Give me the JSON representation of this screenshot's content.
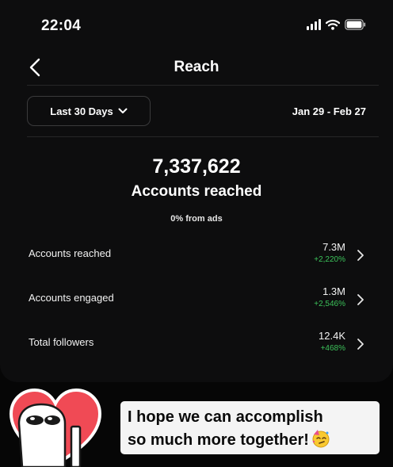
{
  "status_bar": {
    "time": "22:04",
    "icons": [
      "signal-icon",
      "wifi-icon",
      "battery-icon"
    ]
  },
  "nav": {
    "back_icon": "chevron-left-icon",
    "title": "Reach"
  },
  "filter": {
    "range_label": "Last 30 Days",
    "range_icon": "chevron-down-icon",
    "date_range": "Jan 29 - Feb 27"
  },
  "summary": {
    "total": "7,337,622",
    "label": "Accounts reached",
    "ads_note": "0% from ads"
  },
  "metrics": [
    {
      "label": "Accounts reached",
      "value": "7.3M",
      "change": "+2,220%"
    },
    {
      "label": "Accounts engaged",
      "value": "1.3M",
      "change": "+2,546%"
    },
    {
      "label": "Total followers",
      "value": "12.4K",
      "change": "+468%"
    }
  ],
  "sticker": {
    "icon": "heart-character-sticker",
    "caption_lines": [
      "I hope we can accomplish",
      "so much more together!"
    ],
    "emoji": "partying-face-icon"
  },
  "colors": {
    "background": "#0d0d0e",
    "positive_change": "#3cc25a",
    "heart": "#f04a55",
    "caption_bg": "#f4f4f4"
  }
}
